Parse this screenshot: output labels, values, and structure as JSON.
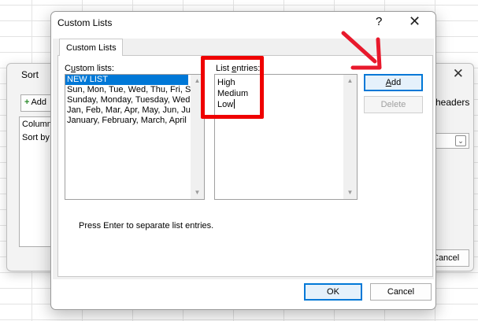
{
  "sort_dialog": {
    "title": "Sort",
    "close_glyph": "✕",
    "add_level_label": "Add",
    "column_label": "Column",
    "sort_by_label": "Sort by",
    "headers_label": "headers",
    "cancel_label": "Cancel"
  },
  "custom_lists_dialog": {
    "title": "Custom Lists",
    "help_glyph": "?",
    "close_glyph": "✕",
    "tab_label": "Custom Lists",
    "custom_lists_label_pre": "C",
    "custom_lists_label_ul": "u",
    "custom_lists_label_post": "stom lists:",
    "custom_lists": [
      "NEW LIST",
      "Sun, Mon, Tue, Wed, Thu, Fri, Sat",
      "Sunday, Monday, Tuesday, Wednesday",
      "Jan, Feb, Mar, Apr, May, Jun, Jul",
      "January, February, March, April"
    ],
    "list_entries_label_pre": "List ",
    "list_entries_label_ul": "e",
    "list_entries_label_post": "ntries:",
    "list_entries": [
      "High",
      "Medium",
      "Low"
    ],
    "add_label_ul": "A",
    "add_label_post": "dd",
    "delete_label": "Delete",
    "hint": "Press Enter to separate list entries.",
    "ok_label": "OK",
    "cancel_label": "Cancel"
  },
  "colors": {
    "highlight": "#ef0000",
    "selection": "#0078d7"
  }
}
